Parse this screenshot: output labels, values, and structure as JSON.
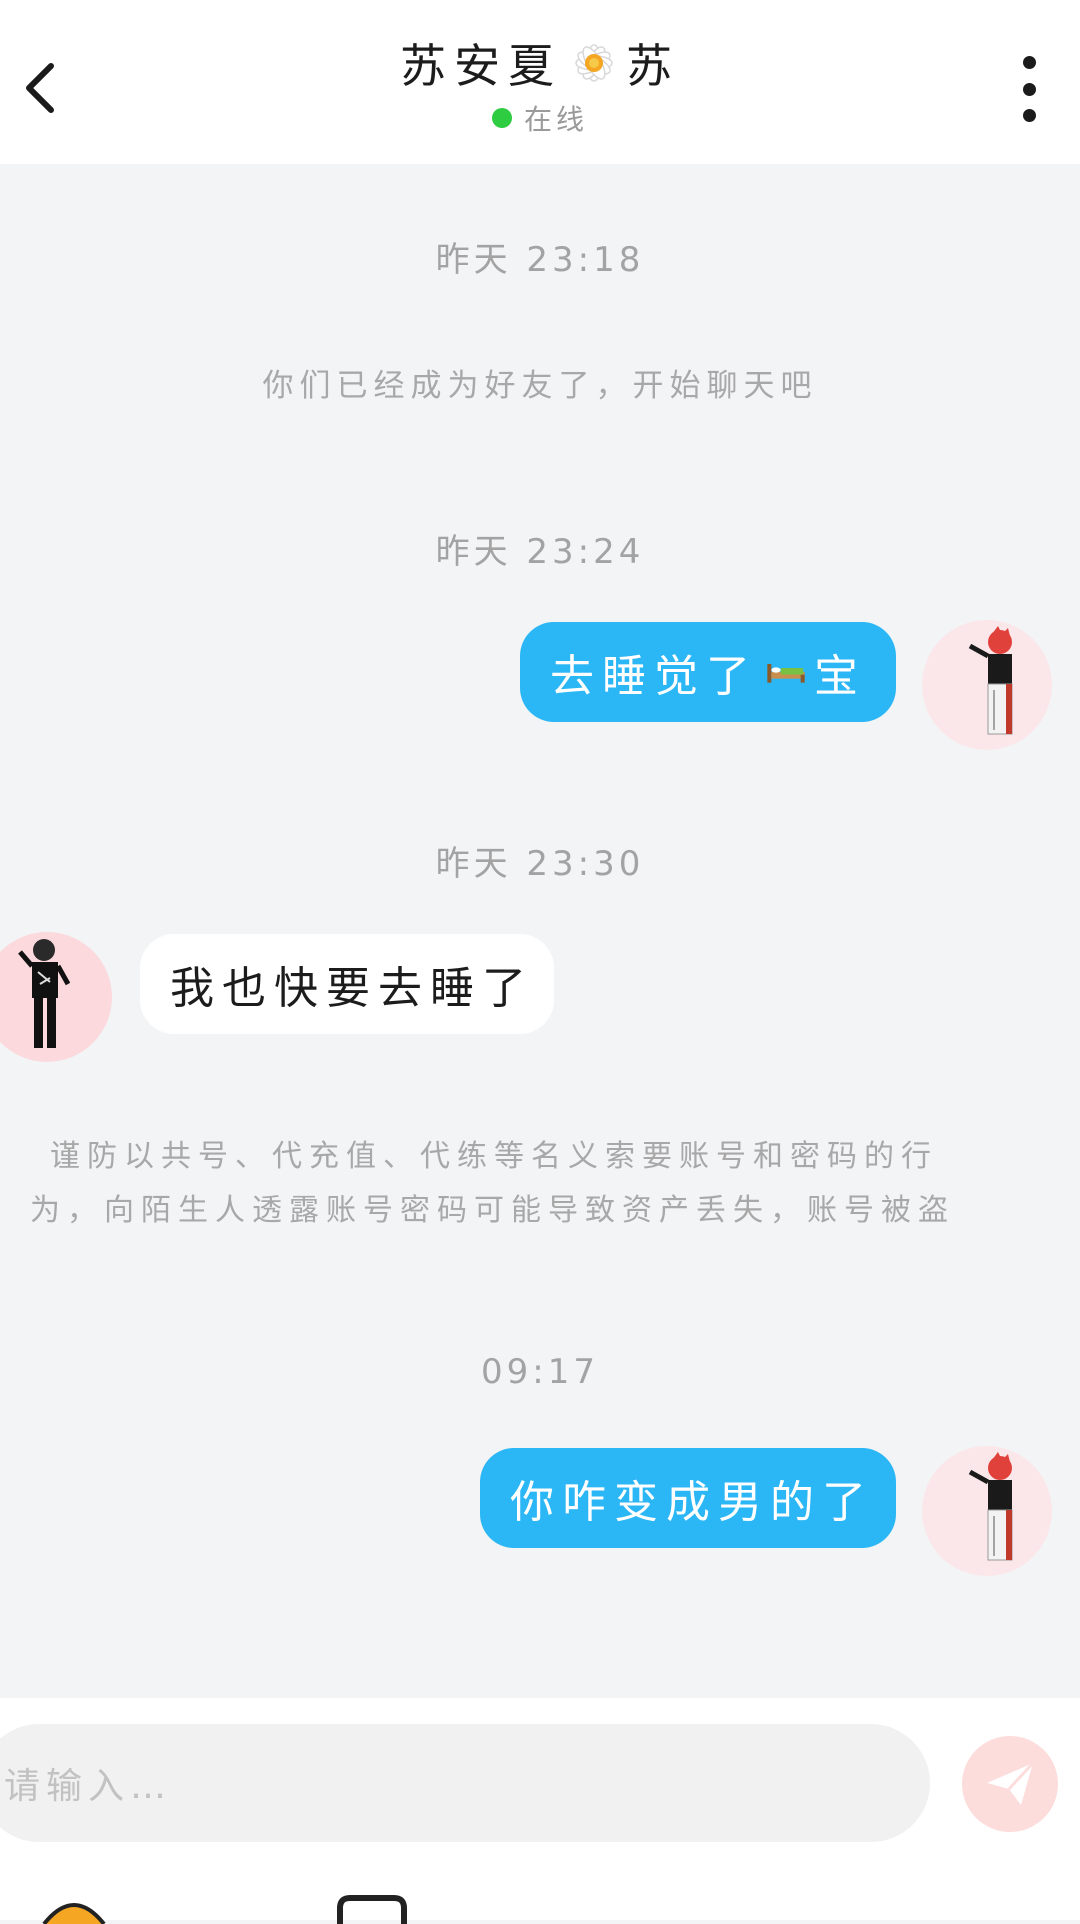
{
  "header": {
    "title_left": "苏安夏",
    "title_right": "苏",
    "status": "在线",
    "colors": {
      "online": "#2ecc40"
    }
  },
  "messages": [
    {
      "kind": "time",
      "text": "昨天 23:18"
    },
    {
      "kind": "system",
      "text": "你们已经成为好友了，开始聊天吧"
    },
    {
      "kind": "time",
      "text": "昨天 23:24"
    },
    {
      "kind": "outgoing",
      "text_before": "去睡觉了",
      "emoji": "bed-icon",
      "text_after": "宝"
    },
    {
      "kind": "time",
      "text": "昨天 23:30"
    },
    {
      "kind": "incoming",
      "text": "我也快要去睡了"
    },
    {
      "kind": "warning",
      "line1": "谨防以共号、代充值、代练等名义索要账号和密码的行",
      "line2": "为，向陌生人透露账号密码可能导致资产丢失，账号被盗"
    },
    {
      "kind": "time",
      "text": "09:17"
    },
    {
      "kind": "outgoing",
      "text": "你咋变成男的了"
    }
  ],
  "composer": {
    "placeholder": "请输入…",
    "send_icon": "paper-plane-icon",
    "colors": {
      "send_bg": "#fddcdc",
      "bubble_out": "#2bb6f5"
    }
  }
}
